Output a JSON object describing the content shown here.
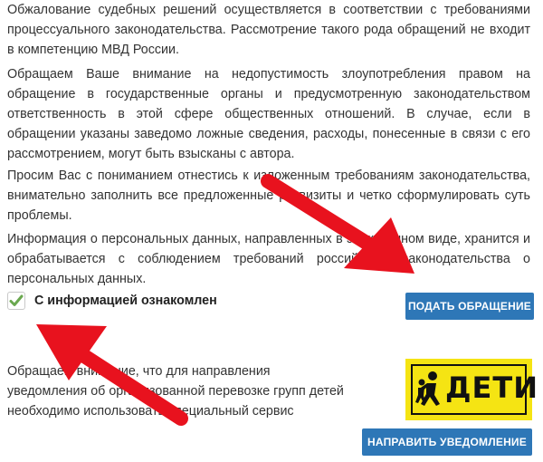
{
  "paragraphs": {
    "p1": "Обжалование судебных решений осуществляется в соответствии с требованиями процессуального законодательства. Рассмотрение такого рода обращений не входит в компетенцию МВД России.",
    "p2": "Обращаем Ваше внимание на недопустимость злоупотребления правом на обращение в государственные органы и предусмотренную законодательством ответственность в этой сфере общественных отношений. В случае, если в обращении указаны заведомо ложные сведения, расходы, понесенные в связи с его рассмотрением, могут быть взысканы с автора.",
    "p3": "Просим Вас с пониманием отнестись к изложенным требованиям законодательства, внимательно заполнить все предложенные реквизиты и четко сформулировать суть проблемы.",
    "p4": "Информация о персональных данных, направленных в электронном виде, хранится и обрабатывается с соблюдением требований российского законодательства о персональных данных."
  },
  "consent": {
    "label": "С информацией ознакомлен",
    "checked": true,
    "check_color": "#6aa84f"
  },
  "buttons": {
    "submit": "ПОДАТЬ ОБРАЩЕНИЕ",
    "notify": "НАПРАВИТЬ УВЕДОМЛЕНИЕ",
    "color": "#2e77b7"
  },
  "notice": {
    "text": "Обращаем внимание, что для направления уведомления об организованной перевозке групп детей необходимо использовать специальный сервис"
  },
  "kids_sign": {
    "text": "ДЕТИ",
    "icon": "children-running-icon",
    "color": "#f5e413"
  },
  "annotations": {
    "arrow_color": "#e8121e",
    "arrows": [
      "arrow-to-submit-button",
      "arrow-to-checkbox"
    ]
  }
}
